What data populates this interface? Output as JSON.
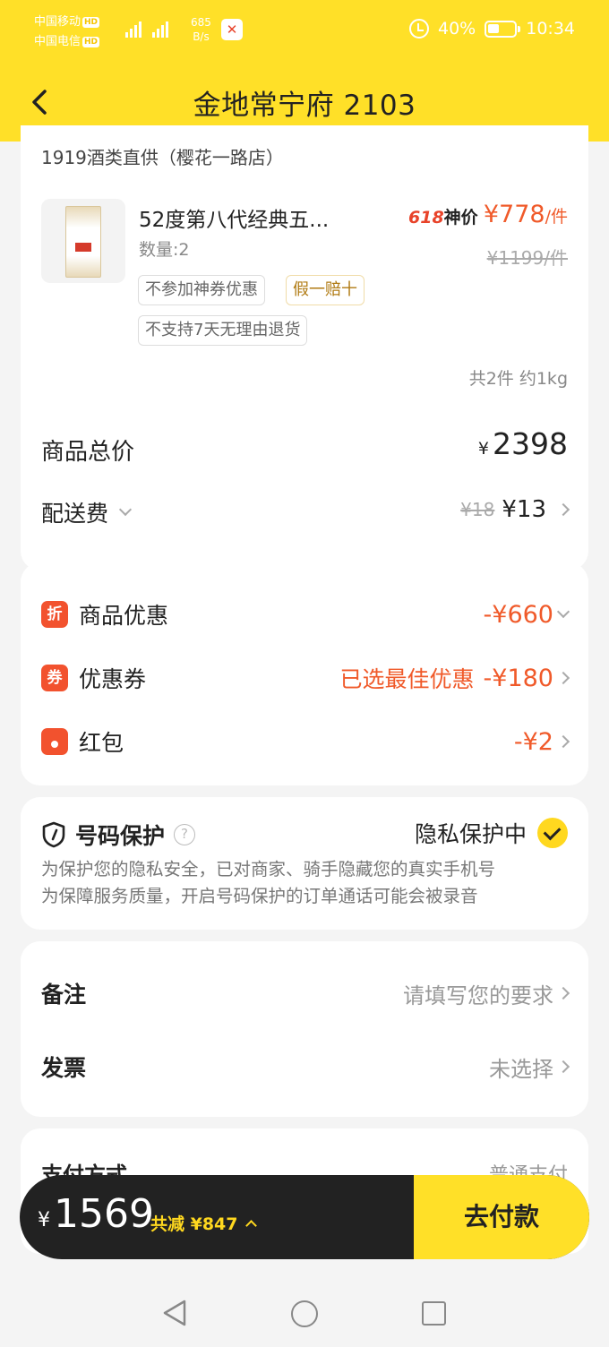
{
  "status_bar": {
    "carrier_1": "中国移动",
    "carrier_2": "中国电信",
    "hd": "HD",
    "net_5g": "5G",
    "net_4g": "4G",
    "speed_value": "685",
    "speed_unit": "B/s",
    "battery": "40%",
    "time": "10:34"
  },
  "header": {
    "title": "金地常宁府 2103"
  },
  "order": {
    "store": "1919酒类直供（樱花一路店）",
    "product_name": "52度第八代经典五...",
    "quantity": "数量:2",
    "promo_618": "618",
    "promo_label": "神价",
    "sale_price": "¥778",
    "sale_unit": "/件",
    "original_price": "¥1199/件",
    "tags": [
      "不参加神券优惠",
      "假一赔十",
      "不支持7天无理由退货"
    ],
    "items_summary": "共2件 约1kg",
    "total_label": "商品总价",
    "total_currency": "¥",
    "total_value": "2398",
    "delivery_label": "配送费",
    "delivery_old": "¥18",
    "delivery_new": "¥13"
  },
  "discounts": [
    {
      "icon": "折",
      "label": "商品优惠",
      "note": "",
      "value": "-¥660"
    },
    {
      "icon": "券",
      "label": "优惠券",
      "note": "已选最佳优惠",
      "value": "-¥180"
    },
    {
      "icon": "",
      "label": "红包",
      "note": "",
      "value": "-¥2"
    }
  ],
  "privacy": {
    "title": "号码保护",
    "help": "?",
    "status": "隐私保护中",
    "desc_1": "为保护您的隐私安全，已对商家、骑手隐藏您的真实手机号",
    "desc_2": "为保障服务质量，开启号码保护的订单通话可能会被录音"
  },
  "notes": {
    "remark_label": "备注",
    "remark_placeholder": "请填写您的要求",
    "invoice_label": "发票",
    "invoice_value": "未选择"
  },
  "payment": {
    "label": "支付方式",
    "value": "普通支付"
  },
  "checkout": {
    "currency": "¥",
    "amount": "1569",
    "saved": "共减 ¥847",
    "button": "去付款"
  },
  "colors": {
    "brand_yellow": "#ffe028",
    "discount_red": "#f05a2a",
    "checkout_dark": "#222222"
  }
}
